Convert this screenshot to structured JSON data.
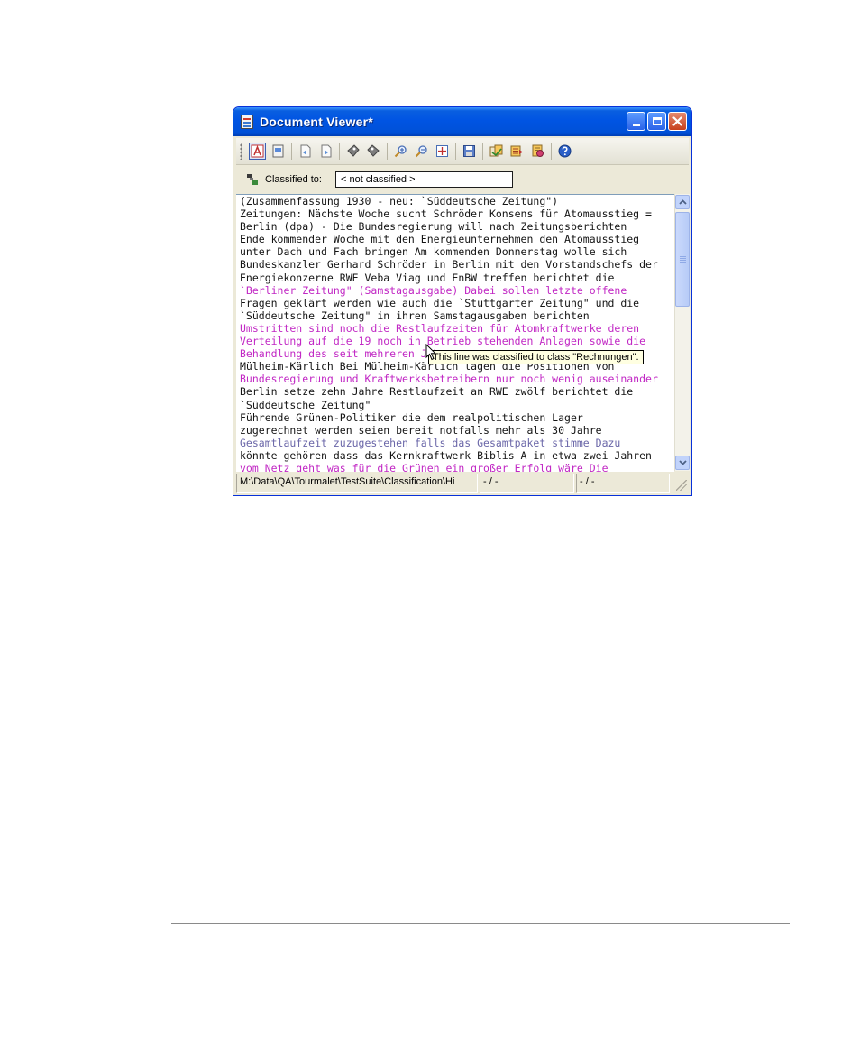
{
  "window": {
    "title": "Document Viewer*",
    "colors": {
      "titlebar": "#0054e3",
      "magenta_text": "#c127c4",
      "slate_text": "#6a66a8"
    }
  },
  "toolbar": {
    "buttons": [
      {
        "name": "text-view-icon",
        "active": true
      },
      {
        "name": "document-view-icon"
      },
      {
        "name": "previous-document-icon"
      },
      {
        "name": "next-document-icon"
      },
      {
        "name": "previous-class-icon"
      },
      {
        "name": "next-class-icon"
      },
      {
        "name": "zoom-in-icon"
      },
      {
        "name": "zoom-out-icon"
      },
      {
        "name": "fit-page-icon"
      },
      {
        "name": "save-icon"
      },
      {
        "name": "classify-icon"
      },
      {
        "name": "export-icon"
      },
      {
        "name": "train-icon"
      },
      {
        "name": "help-icon"
      }
    ]
  },
  "classification": {
    "label": "Classified to:",
    "value": "< not classified >"
  },
  "document": {
    "lines": [
      {
        "text": "(Zusammenfassung 1930 - neu: `Süddeutsche Zeitung\")",
        "style": "black"
      },
      {
        "text": "Zeitungen: Nächste Woche sucht Schröder Konsens für Atomausstieg =",
        "style": "black"
      },
      {
        "text": "Berlin (dpa) - Die Bundesregierung will nach Zeitungsberichten",
        "style": "black"
      },
      {
        "text": "Ende kommender Woche mit den Energieunternehmen den Atomausstieg",
        "style": "black"
      },
      {
        "text": "unter Dach und Fach bringen Am kommenden Donnerstag wolle sich",
        "style": "black"
      },
      {
        "text": "Bundeskanzler Gerhard Schröder in Berlin mit den Vorstandschefs der",
        "style": "black"
      },
      {
        "text": "Energiekonzerne RWE Veba Viag und EnBW treffen berichtet die",
        "style": "black"
      },
      {
        "text": "`Berliner Zeitung\" (Samstagausgabe) Dabei sollen letzte offene",
        "style": "magenta"
      },
      {
        "text": "Fragen geklärt werden wie auch die `Stuttgarter Zeitung\" und die",
        "style": "black"
      },
      {
        "text": "`Süddeutsche Zeitung\" in ihren Samstagausgaben berichten",
        "style": "black"
      },
      {
        "text": "Umstritten sind noch die Restlaufzeiten für Atomkraftwerke deren",
        "style": "magenta"
      },
      {
        "text": "Verteilung auf die 19 noch in Betrieb stehenden Anlagen sowie die",
        "style": "magenta"
      },
      {
        "text": "Behandlung des seit mehreren Jahren",
        "style": "magenta"
      },
      {
        "text": "Mülheim-Kärlich Bei Mülheim-Kärlich lagen die Positionen von",
        "style": "black"
      },
      {
        "text": "Bundesregierung und Kraftwerksbetreibern nur noch wenig auseinander",
        "style": "magenta"
      },
      {
        "text": "Berlin setze zehn Jahre Restlaufzeit an RWE zwölf berichtet die",
        "style": "black"
      },
      {
        "text": "`Süddeutsche Zeitung\"",
        "style": "black"
      },
      {
        "text": "Führende Grünen-Politiker die dem realpolitischen Lager",
        "style": "black"
      },
      {
        "text": "zugerechnet werden seien bereit notfalls mehr als 30 Jahre",
        "style": "black"
      },
      {
        "text": "Gesamtlaufzeit zuzugestehen falls das Gesamtpaket stimme Dazu",
        "style": "slate"
      },
      {
        "text": "könnte gehören dass das Kernkraftwerk Biblis A in etwa zwei Jahren",
        "style": "black"
      },
      {
        "text": "vom Netz geht was für die Grünen ein großer Erfolg wäre Die",
        "style": "magenta"
      }
    ]
  },
  "tooltip": {
    "text": "This line was classified to class \"Rechnungen\"."
  },
  "statusbar": {
    "path": "M:\\Data\\QA\\Tourmalet\\TestSuite\\Classification\\Hi",
    "field2": "- / -",
    "field3": "- / -"
  }
}
